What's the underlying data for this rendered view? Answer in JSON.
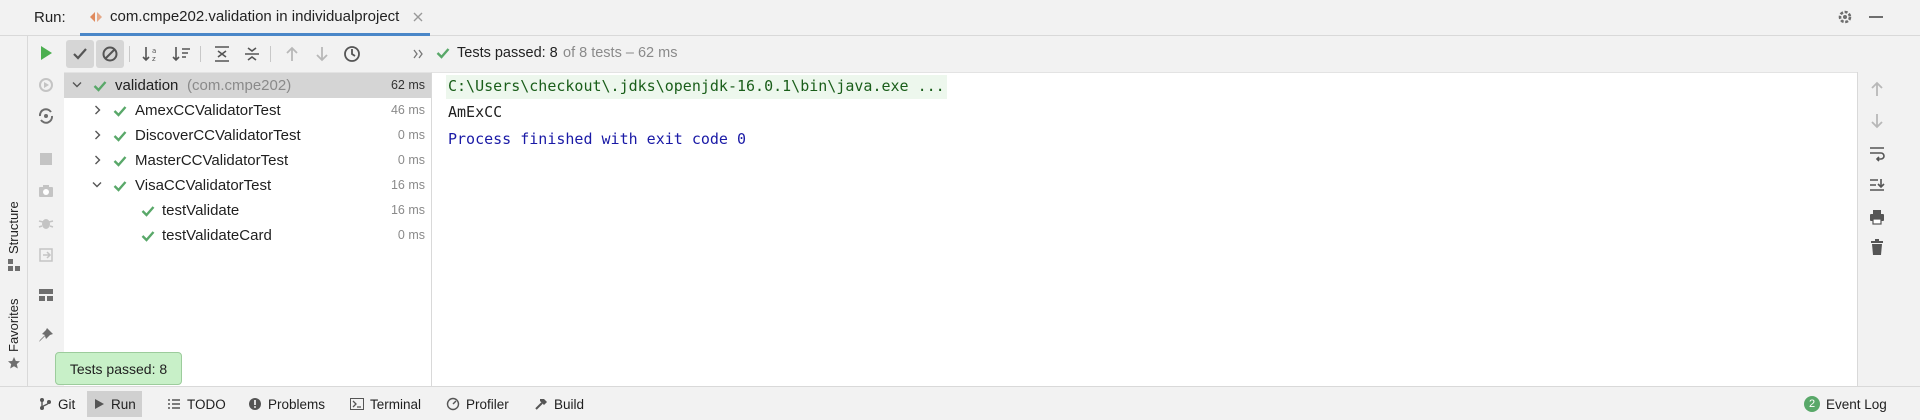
{
  "header": {
    "run_label": "Run:",
    "tab_title": "com.cmpe202.validation in individualproject",
    "close_icon": "close-icon",
    "settings_icon": "gear-icon",
    "minimize_icon": "minimize-icon"
  },
  "left_stripe": {
    "structure_label": "Structure",
    "favorites_label": "Favorites"
  },
  "status": {
    "prefix": "Tests passed: 8",
    "suffix": "of 8 tests – 62 ms"
  },
  "tree": {
    "root": {
      "name": "validation",
      "pkg": "(com.cmpe202)",
      "time": "62 ms"
    },
    "items": [
      {
        "name": "AmexCCValidatorTest",
        "time": "46 ms"
      },
      {
        "name": "DiscoverCCValidatorTest",
        "time": "0 ms"
      },
      {
        "name": "MasterCCValidatorTest",
        "time": "0 ms"
      },
      {
        "name": "VisaCCValidatorTest",
        "time": "16 ms"
      }
    ],
    "children": [
      {
        "name": "testValidate",
        "time": "16 ms"
      },
      {
        "name": "testValidateCard",
        "time": "0 ms"
      }
    ]
  },
  "console": {
    "command": "C:\\Users\\checkout\\.jdks\\openjdk-16.0.1\\bin\\java.exe ...",
    "output": "AmExCC",
    "exit": "Process finished with exit code 0"
  },
  "tooltip": "Tests passed: 8",
  "bottom_tabs": {
    "git": "Git",
    "run": "Run",
    "todo": "TODO",
    "problems": "Problems",
    "terminal": "Terminal",
    "profiler": "Profiler",
    "build": "Build",
    "event_log_count": "2",
    "event_log": "Event Log"
  },
  "colors": {
    "pass_green": "#59a869",
    "run_green": "#4caf50",
    "console_blue": "#1a1aa6",
    "command_bg": "#edf7ed"
  }
}
